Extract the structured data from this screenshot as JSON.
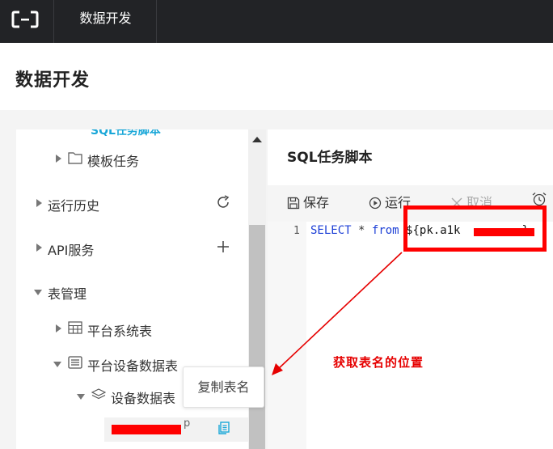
{
  "topbar": {
    "title": "数据开发"
  },
  "page": {
    "title": "数据开发"
  },
  "tree": {
    "cut_text": "SQL任务脚本",
    "items": [
      {
        "label": "模板任务"
      },
      {
        "label": "运行历史"
      },
      {
        "label": "API服务"
      },
      {
        "label": "表管理"
      },
      {
        "label": "平台系统表"
      },
      {
        "label": "平台设备数据表"
      },
      {
        "label": "设备数据表"
      }
    ],
    "selected_suffix": "p"
  },
  "tooltip": {
    "text": "复制表名"
  },
  "editor": {
    "tab_title": "SQL任务脚本",
    "toolbar": {
      "save": "保存",
      "run": "运行",
      "cancel": "取消"
    },
    "line_number": "1",
    "code": {
      "keyword_select": "SELECT",
      "star": "*",
      "keyword_from": "from",
      "var_prefix": "${pk.a1k",
      "var_suffix": "}"
    }
  },
  "annotation": {
    "text": "获取表名的位置"
  },
  "colors": {
    "accent": "#1aa7d8",
    "annotation": "#ff0000",
    "keyword": "#1c3fd6"
  }
}
